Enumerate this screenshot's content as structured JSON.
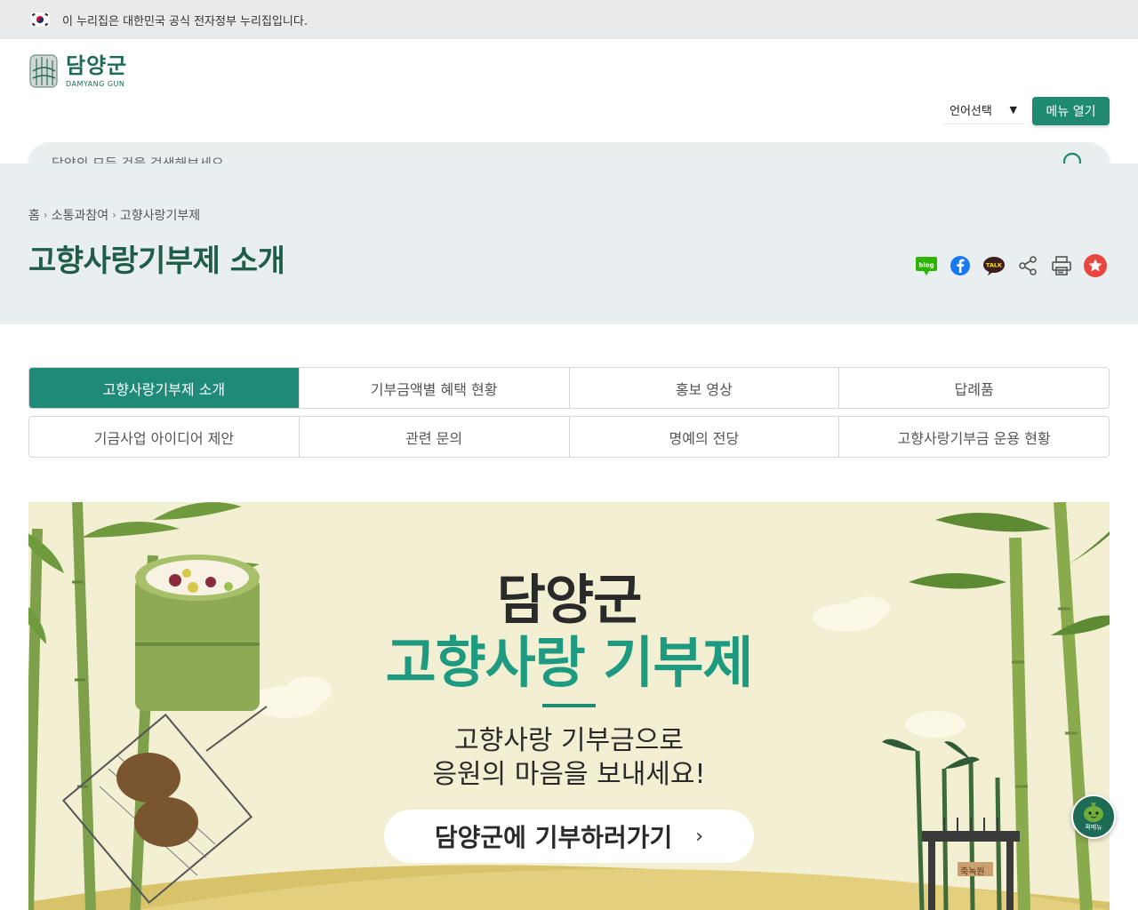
{
  "gov_bar": {
    "text": "이 누리집은 대한민국 공식 전자정부 누리집입니다."
  },
  "header": {
    "logo_name": "담양군",
    "logo_sub": "DAMYANG GUN",
    "language": "언어선택",
    "menu_button": "메뉴 열기",
    "search_placeholder": "담양의 모든 것을 검색해보세요."
  },
  "page": {
    "breadcrumb": [
      "홈",
      "소통과참여",
      "고향사랑기부제"
    ],
    "title": "고향사랑기부제 소개",
    "share_icons": [
      "blog-icon",
      "facebook-icon",
      "kakaotalk-icon",
      "share-icon",
      "print-icon",
      "favorite-icon"
    ]
  },
  "tabs": {
    "row1": [
      "고향사랑기부제 소개",
      "기부금액별 혜택 현황",
      "홍보 영상",
      "답례품"
    ],
    "row2": [
      "기금사업 아이디어 제안",
      "관련 문의",
      "명예의 전당",
      "고향사랑기부금 운용 현황"
    ],
    "active": "고향사랑기부제 소개"
  },
  "banner": {
    "heading1": "담양군",
    "heading2": "고향사랑 기부제",
    "desc_line1": "고향사랑 기부금으로",
    "desc_line2": "응원의 마음을 보내세요!",
    "cta": "담양군에 기부하러가기",
    "cta_chevron": "›",
    "sign_text": "죽녹원"
  },
  "quick_menu": {
    "label": "퀵메뉴"
  },
  "colors": {
    "brand": "#1f8a70",
    "title": "#1f5c4a",
    "banner_bg": "#f3efd2",
    "banner_accent": "#1e9a80"
  }
}
